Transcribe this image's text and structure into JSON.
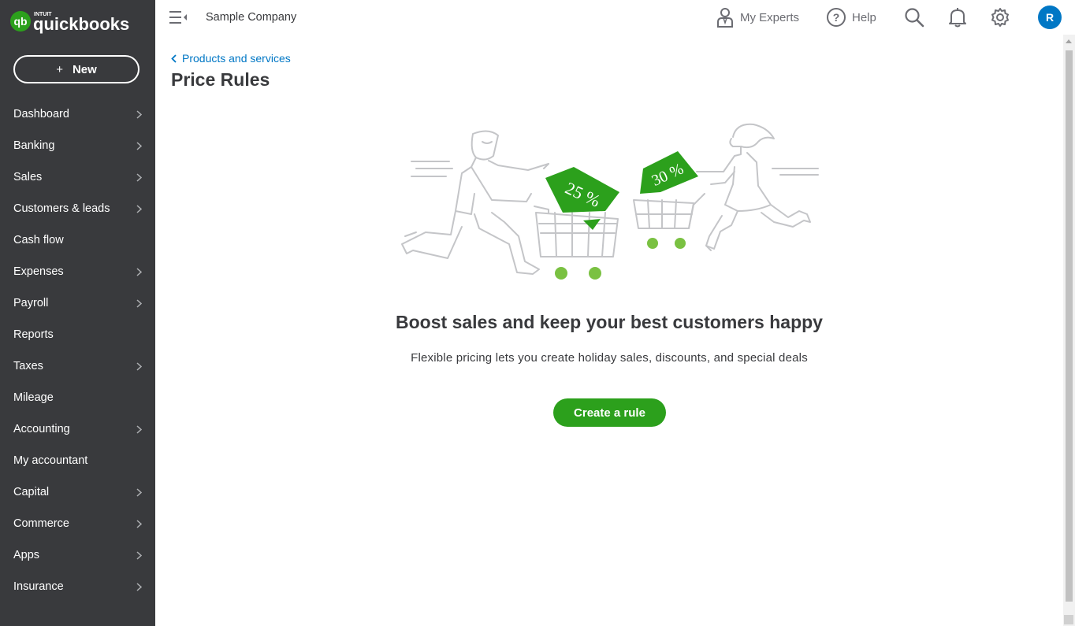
{
  "brand": {
    "logo_text": "quickbooks",
    "logo_small": "INTUIT",
    "color": "#2ca01c"
  },
  "sidebar": {
    "new_label": "New",
    "new_icon": "plus-icon",
    "items": [
      {
        "label": "Dashboard",
        "has_chevron": true
      },
      {
        "label": "Banking",
        "has_chevron": true
      },
      {
        "label": "Sales",
        "has_chevron": true
      },
      {
        "label": "Customers & leads",
        "has_chevron": true
      },
      {
        "label": "Cash flow",
        "has_chevron": false
      },
      {
        "label": "Expenses",
        "has_chevron": true
      },
      {
        "label": "Payroll",
        "has_chevron": true
      },
      {
        "label": "Reports",
        "has_chevron": false
      },
      {
        "label": "Taxes",
        "has_chevron": true
      },
      {
        "label": "Mileage",
        "has_chevron": false
      },
      {
        "label": "Accounting",
        "has_chevron": true
      },
      {
        "label": "My accountant",
        "has_chevron": false
      },
      {
        "label": "Capital",
        "has_chevron": true
      },
      {
        "label": "Commerce",
        "has_chevron": true
      },
      {
        "label": "Apps",
        "has_chevron": true
      },
      {
        "label": "Insurance",
        "has_chevron": true
      }
    ]
  },
  "header": {
    "company": "Sample Company",
    "my_experts": "My Experts",
    "help": "Help",
    "avatar_initial": "R"
  },
  "page": {
    "breadcrumb": "Products and services",
    "title": "Price Rules",
    "illustration": {
      "tag_left": "25 %",
      "tag_right": "30 %"
    },
    "headline": "Boost sales and keep your best customers happy",
    "subtext": "Flexible pricing lets you create holiday sales, discounts, and special deals",
    "cta": "Create a rule"
  },
  "colors": {
    "sidebar_bg": "#393a3d",
    "accent_green": "#2ca01c",
    "link_blue": "#0077c5",
    "avatar_blue": "#0077c5"
  }
}
